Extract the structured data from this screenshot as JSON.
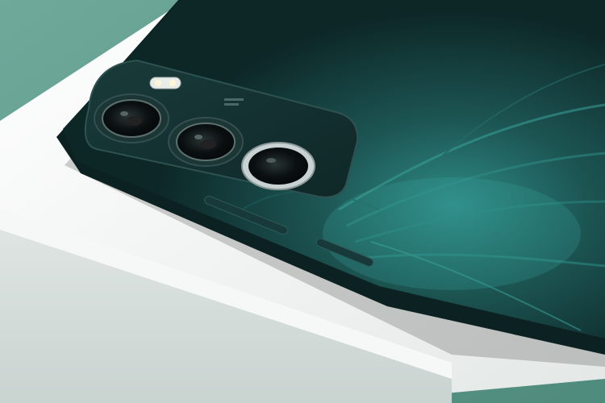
{
  "photo": {
    "subject": "",
    "palette": {
      "background": "#5e9a8c",
      "box_white": "#eef1ef",
      "phone_body": "#0f2c2c",
      "phone_accent": "#2d7f7b",
      "camera_ring": "#c9d2d2"
    },
    "camera_module_text": "",
    "icons": [
      "flash-icon",
      "camera-lens-icon"
    ]
  }
}
